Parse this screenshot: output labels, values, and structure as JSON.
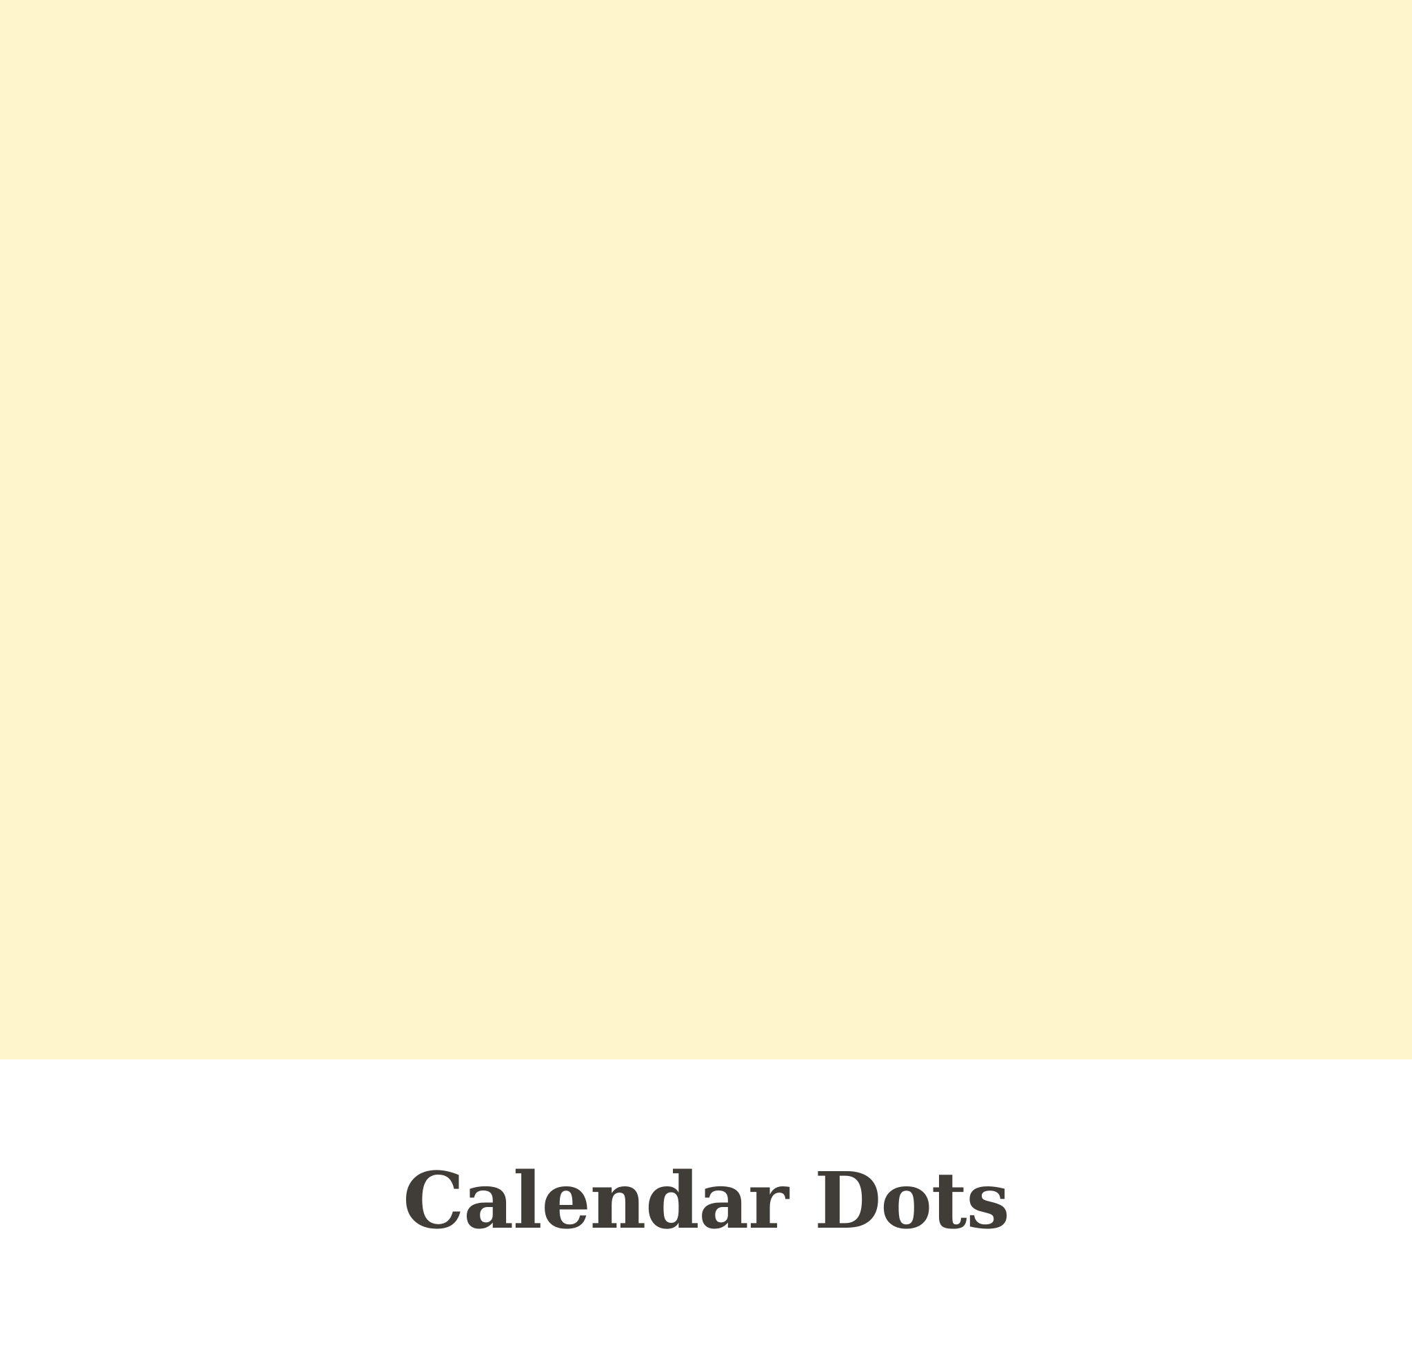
{
  "banner": {
    "background_color": "#fef5cd"
  },
  "title": {
    "text": "Calendar Dots",
    "color": "#403d38"
  }
}
